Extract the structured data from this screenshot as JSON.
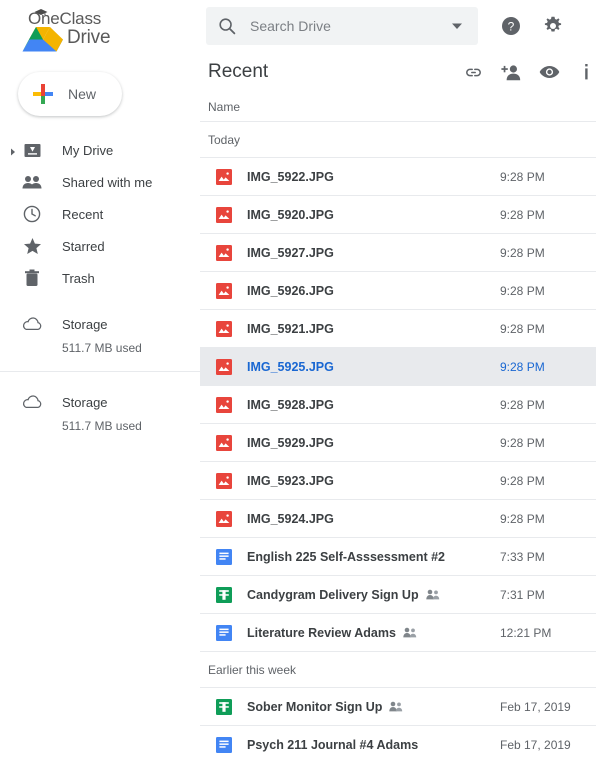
{
  "brand": {
    "line1": "OneClass",
    "line2": "Drive",
    "cap_icon": "graduation-cap-icon",
    "drive_icon": "google-drive-triangle-icon"
  },
  "new_button": {
    "label": "New",
    "icon": "plus-icon"
  },
  "sidebar": {
    "items": [
      {
        "label": "My Drive",
        "icon": "my-drive-icon",
        "has_caret": true
      },
      {
        "label": "Shared with me",
        "icon": "people-icon",
        "has_caret": false
      },
      {
        "label": "Recent",
        "icon": "clock-icon",
        "has_caret": false
      },
      {
        "label": "Starred",
        "icon": "star-icon",
        "has_caret": false
      },
      {
        "label": "Trash",
        "icon": "trash-icon",
        "has_caret": false
      }
    ],
    "storage_blocks": [
      {
        "label": "Storage",
        "used": "511.7 MB used",
        "icon": "cloud-icon"
      },
      {
        "label": "Storage",
        "used": "511.7 MB used",
        "icon": "cloud-icon"
      }
    ]
  },
  "search": {
    "placeholder": "Search Drive",
    "value": "",
    "search_icon": "search-icon",
    "dropdown_icon": "chevron-down-icon"
  },
  "topbar": {
    "help_icon": "help-circle-icon",
    "settings_icon": "gear-icon"
  },
  "header": {
    "title": "Recent",
    "actions": [
      {
        "icon": "link-icon",
        "name": "get-link-button"
      },
      {
        "icon": "person-add-icon",
        "name": "share-button"
      },
      {
        "icon": "eye-icon",
        "name": "preview-button"
      },
      {
        "icon": "info-icon",
        "name": "details-button"
      }
    ]
  },
  "columns": {
    "name": "Name"
  },
  "groups": [
    {
      "label": "Today",
      "files": [
        {
          "name": "IMG_5922.JPG",
          "time": "9:28 PM",
          "type": "image",
          "shared": false,
          "selected": false
        },
        {
          "name": "IMG_5920.JPG",
          "time": "9:28 PM",
          "type": "image",
          "shared": false,
          "selected": false
        },
        {
          "name": "IMG_5927.JPG",
          "time": "9:28 PM",
          "type": "image",
          "shared": false,
          "selected": false
        },
        {
          "name": "IMG_5926.JPG",
          "time": "9:28 PM",
          "type": "image",
          "shared": false,
          "selected": false
        },
        {
          "name": "IMG_5921.JPG",
          "time": "9:28 PM",
          "type": "image",
          "shared": false,
          "selected": false
        },
        {
          "name": "IMG_5925.JPG",
          "time": "9:28 PM",
          "type": "image",
          "shared": false,
          "selected": true
        },
        {
          "name": "IMG_5928.JPG",
          "time": "9:28 PM",
          "type": "image",
          "shared": false,
          "selected": false
        },
        {
          "name": "IMG_5929.JPG",
          "time": "9:28 PM",
          "type": "image",
          "shared": false,
          "selected": false
        },
        {
          "name": "IMG_5923.JPG",
          "time": "9:28 PM",
          "type": "image",
          "shared": false,
          "selected": false
        },
        {
          "name": "IMG_5924.JPG",
          "time": "9:28 PM",
          "type": "image",
          "shared": false,
          "selected": false
        },
        {
          "name": "English 225 Self-Asssessment #2",
          "time": "7:33 PM",
          "type": "doc",
          "shared": false,
          "selected": false
        },
        {
          "name": "Candygram Delivery Sign Up",
          "time": "7:31 PM",
          "type": "sheet",
          "shared": true,
          "selected": false
        },
        {
          "name": "Literature Review Adams",
          "time": "12:21 PM",
          "type": "doc",
          "shared": true,
          "selected": false
        }
      ]
    },
    {
      "label": "Earlier this week",
      "files": [
        {
          "name": "Sober Monitor Sign Up",
          "time": "Feb 17, 2019",
          "type": "sheet",
          "shared": true,
          "selected": false
        },
        {
          "name": "Psych 211 Journal #4 Adams",
          "time": "Feb 17, 2019",
          "type": "doc",
          "shared": false,
          "selected": false
        }
      ]
    }
  ],
  "colors": {
    "image_icon": "#e8453c",
    "doc_icon": "#4285f4",
    "sheet_icon": "#0f9d58",
    "selected_text": "#1967d2",
    "selected_row_bg": "#e8eaed",
    "text_primary": "#3c4043",
    "text_secondary": "#5f6368"
  }
}
